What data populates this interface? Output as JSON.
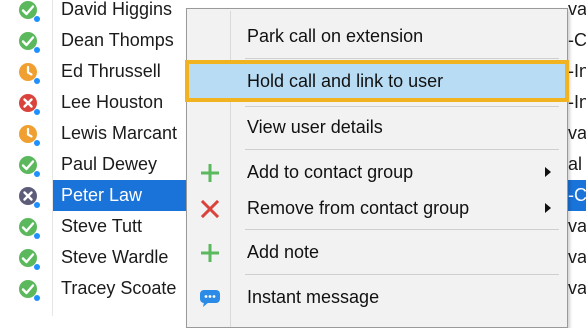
{
  "contacts": [
    {
      "name": "David Higgins",
      "status": "available",
      "right": "va"
    },
    {
      "name": "Dean Thomps",
      "status": "available",
      "right": "-C"
    },
    {
      "name": "Ed Thrussell",
      "status": "away",
      "right": "-In"
    },
    {
      "name": "Lee Houston",
      "status": "busy",
      "right": "-In"
    },
    {
      "name": "Lewis Marcant",
      "status": "away",
      "right": "va"
    },
    {
      "name": "Paul Dewey",
      "status": "available",
      "right": "al"
    },
    {
      "name": "Peter Law",
      "status": "offline",
      "right": "-C",
      "selected": true
    },
    {
      "name": "Steve Tutt",
      "status": "available",
      "right": "va"
    },
    {
      "name": "Steve Wardle",
      "status": "available",
      "right": "va"
    },
    {
      "name": "Tracey Scoate",
      "status": "available",
      "right": "va"
    }
  ],
  "status_colors": {
    "available": "#5cb85c",
    "away": "#f0a030",
    "busy": "#d9433b",
    "offline": "#5d5d7a",
    "badge": "#1e90ff"
  },
  "context_menu": {
    "items": [
      {
        "label": "Park call on extension",
        "icon": "",
        "submenu": false
      },
      {
        "label": "Hold call and link to user",
        "icon": "",
        "submenu": false,
        "highlighted": true
      },
      {
        "label": "View user details",
        "icon": "",
        "submenu": false
      },
      {
        "label": "Add to contact group",
        "icon": "plus-icon",
        "submenu": true
      },
      {
        "label": "Remove from contact group",
        "icon": "x-icon",
        "submenu": true
      },
      {
        "label": "Add note",
        "icon": "plus-icon",
        "submenu": false
      },
      {
        "label": "Instant message",
        "icon": "chat-bubble-icon",
        "submenu": false
      }
    ],
    "highlight_color": "#b9dcf5",
    "highlight_border": "#f2b320"
  }
}
